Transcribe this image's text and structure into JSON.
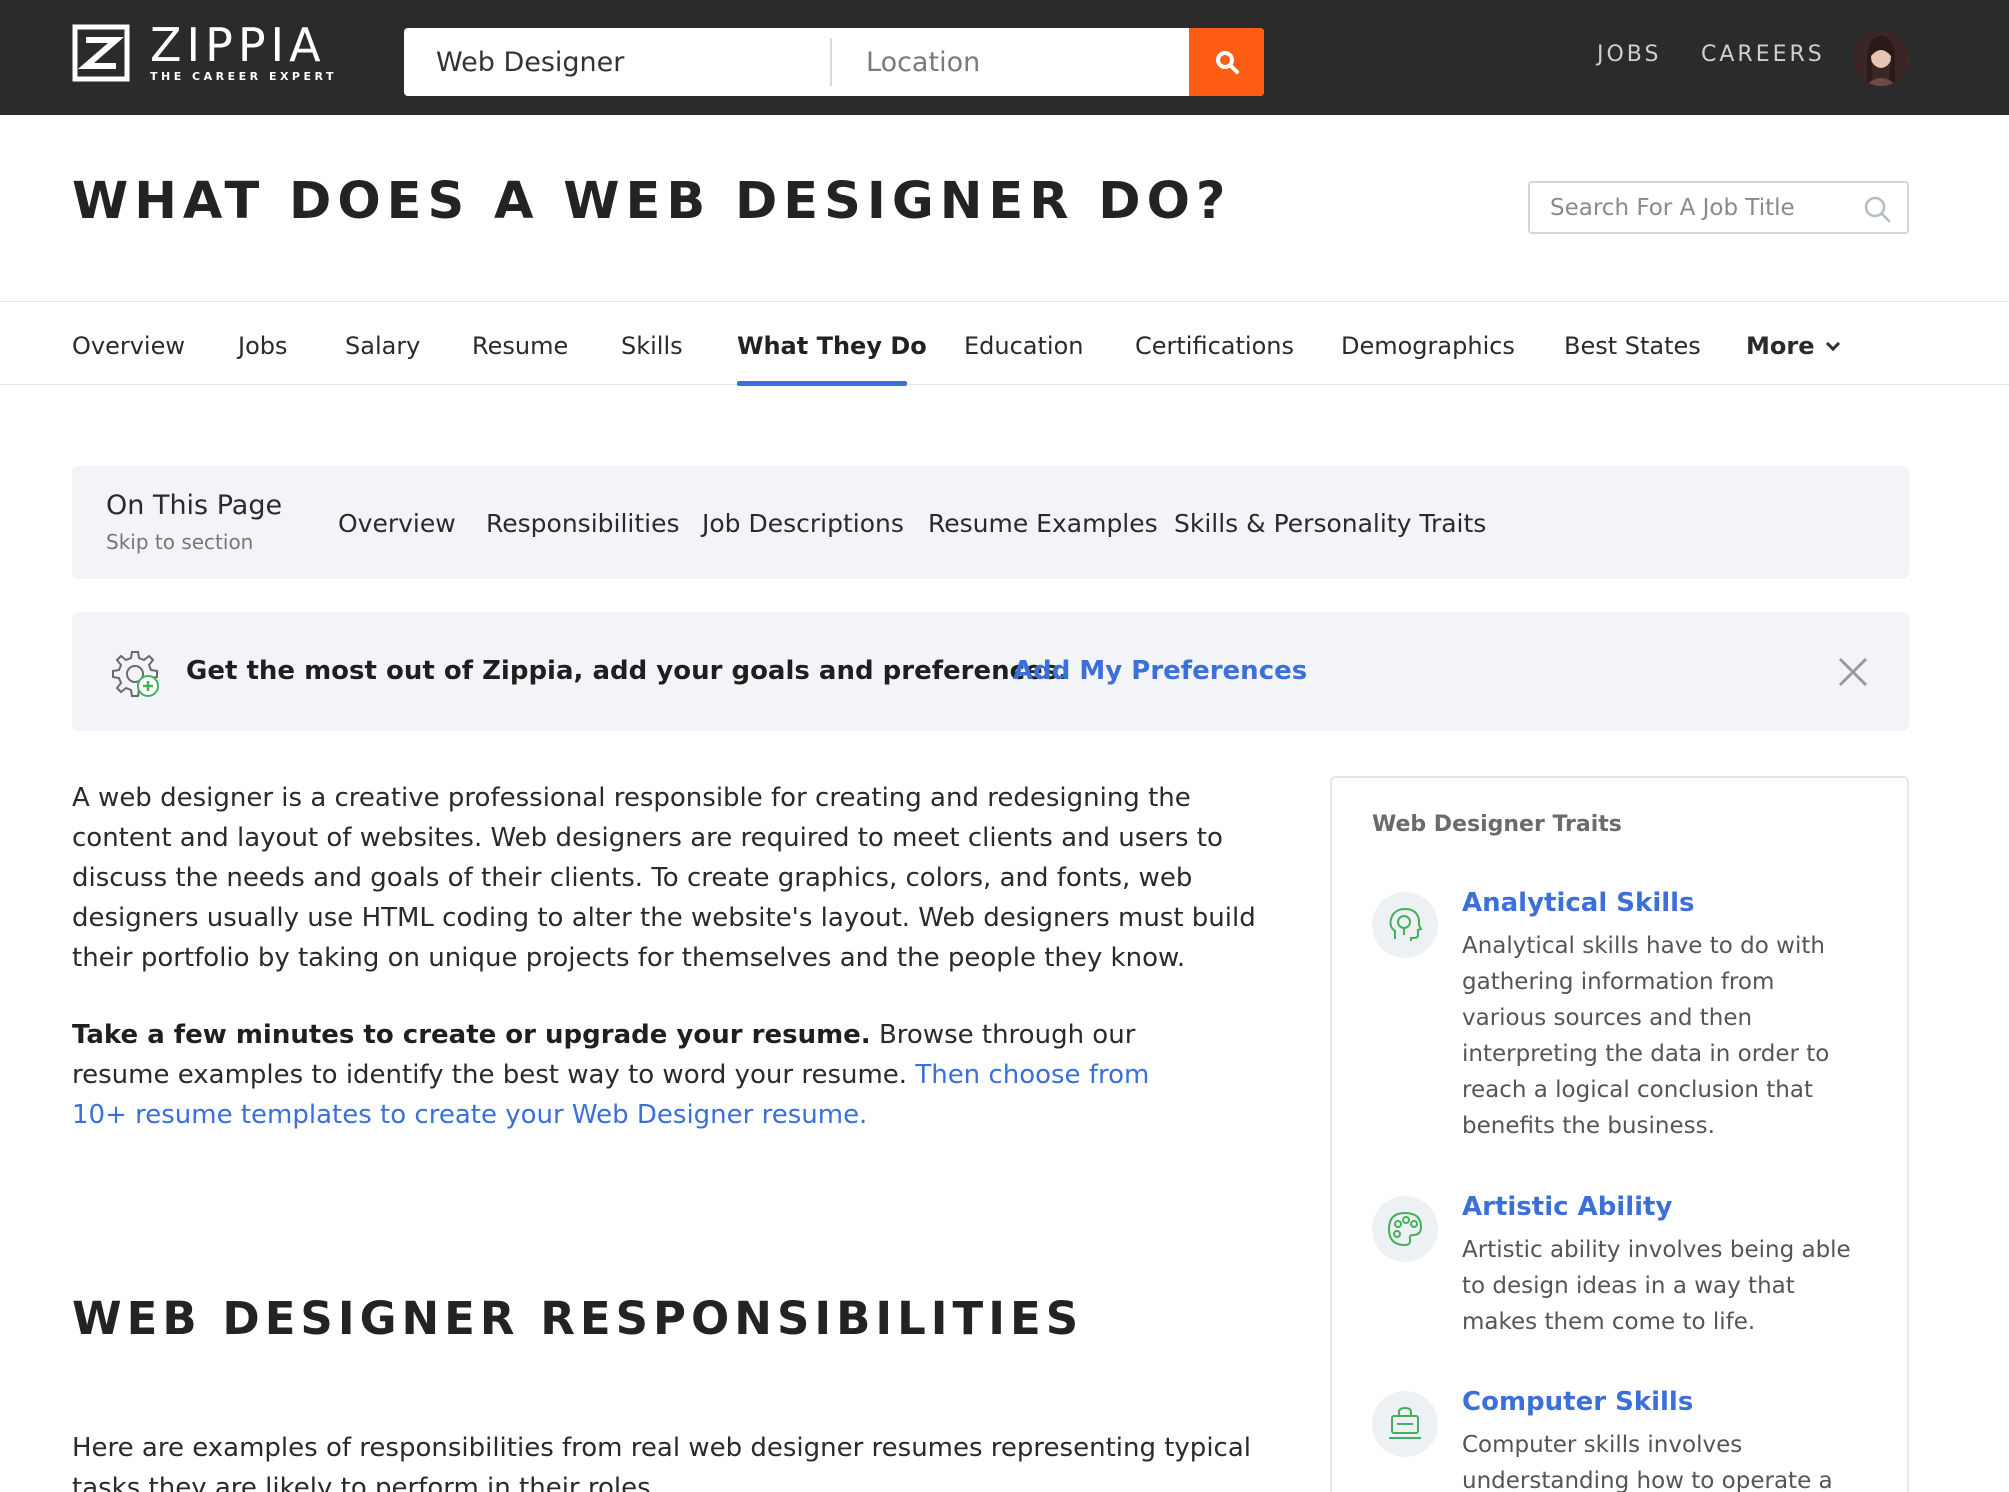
{
  "header": {
    "logo_name": "ZIPPIA",
    "logo_tagline": "THE CAREER EXPERT",
    "search_keyword": "Web Designer",
    "search_location_placeholder": "Location",
    "nav_jobs": "JOBS",
    "nav_careers": "CAREERS",
    "brand_color": "#ff5d16"
  },
  "page": {
    "title": "WHAT DOES A WEB DESIGNER DO?",
    "job_search_placeholder": "Search For A Job Title"
  },
  "tabs": {
    "items": [
      "Overview",
      "Jobs",
      "Salary",
      "Resume",
      "Skills",
      "What They Do",
      "Education",
      "Certifications",
      "Demographics",
      "Best States",
      "More"
    ],
    "active": "What They Do",
    "accent_color": "#3b6fd9"
  },
  "on_this_page": {
    "title": "On This Page",
    "subtitle": "Skip to section",
    "links": [
      "Overview",
      "Responsibilities",
      "Job Descriptions",
      "Resume Examples",
      "Skills & Personality Traits"
    ]
  },
  "preferences": {
    "text": "Get the most out of Zippia, add your goals and preferences.",
    "link": "Add My Preferences"
  },
  "content": {
    "intro": "A web designer is a creative professional responsible for creating and redesigning the content and layout of websites. Web designers are required to meet clients and users to discuss the needs and goals of their clients. To create graphics, colors, and fonts, web designers usually use HTML coding to alter the website's layout. Web designers must build their portfolio by taking on unique projects for themselves and the people they know.",
    "cta_bold": "Take a few minutes to create or upgrade your resume.",
    "cta_text": " Browse through our resume examples to identify the best way to word your resume. ",
    "cta_link": "Then choose from 10+ resume templates to create your Web Designer resume.",
    "responsibilities_title": "WEB DESIGNER RESPONSIBILITIES",
    "responsibilities_intro": "Here are examples of responsibilities from real web designer resumes representing typical tasks they are likely to perform in their roles."
  },
  "traits": {
    "title": "Web Designer Traits",
    "items": [
      {
        "name": "Analytical Skills",
        "icon": "analytical-skills-icon",
        "description": "Analytical skills have to do with gathering information from various sources and then interpreting the data in order to reach a logical conclusion that benefits the business."
      },
      {
        "name": "Artistic Ability",
        "icon": "artistic-ability-icon",
        "description": "Artistic ability involves being able to design ideas in a way that makes them come to life."
      },
      {
        "name": "Computer Skills",
        "icon": "computer-skills-icon",
        "description": "Computer skills involves understanding how to operate a"
      }
    ],
    "icon_color": "#43b05c"
  }
}
